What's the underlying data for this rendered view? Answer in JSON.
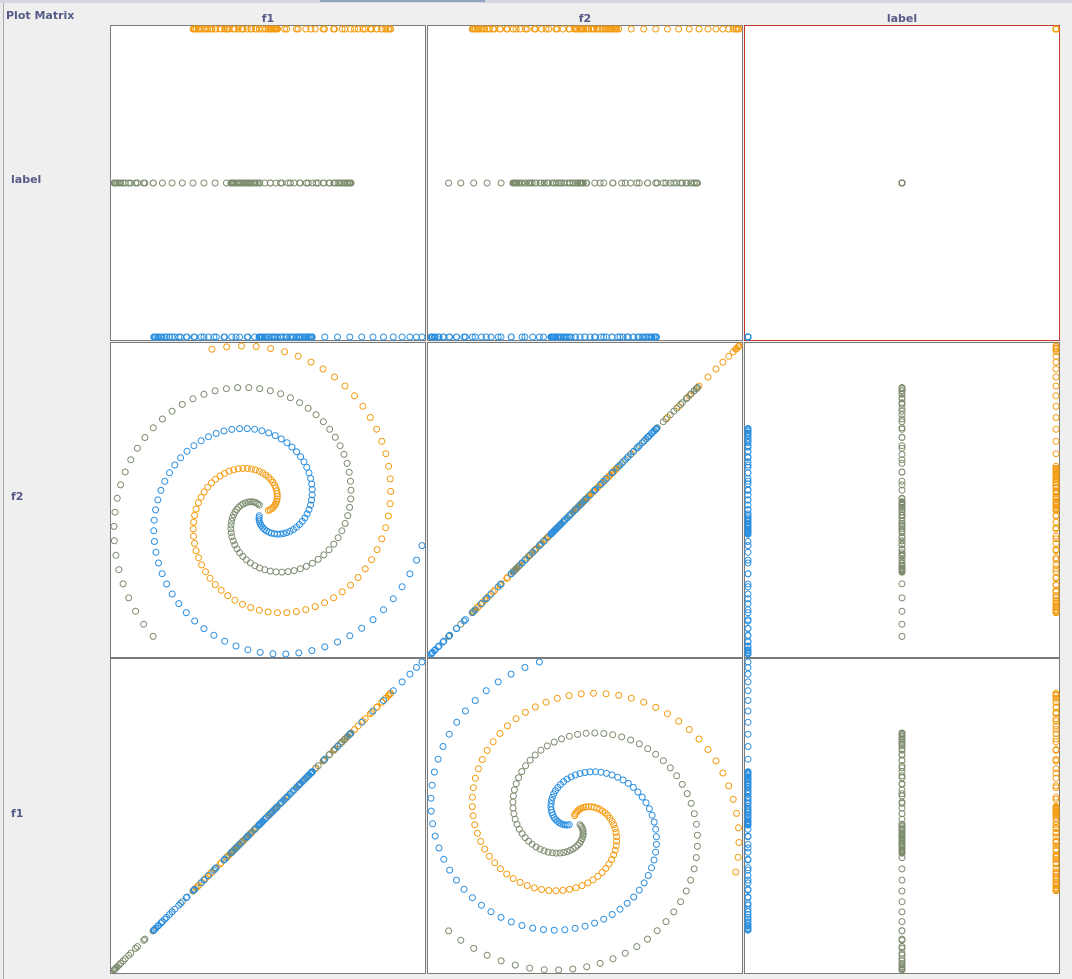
{
  "title": "Plot Matrix",
  "columns": [
    "f1",
    "f2",
    "label"
  ],
  "rows": [
    "label",
    "f2",
    "f1"
  ],
  "colors": {
    "class_a": "#f39c12",
    "class_b": "#7d8c6e",
    "class_c": "#2b8fe0",
    "selected_border": "#c0392b",
    "cell_border": "#7a7a7a"
  },
  "chart_data": {
    "type": "scatter",
    "variables": [
      "f1",
      "f2",
      "label"
    ],
    "label_values": {
      "class_a": 2,
      "class_b": 1,
      "class_c": 0
    },
    "ranges": {
      "f1": [
        -1,
        1
      ],
      "f2": [
        -1,
        1
      ],
      "label": [
        0,
        2
      ]
    },
    "grid": false,
    "series": [
      {
        "key": "class_a",
        "label": 2,
        "radius_start": 0.04,
        "radius_end": 1.08,
        "phase": 0,
        "turns": 1.3
      },
      {
        "key": "class_b",
        "label": 1,
        "radius_start": 0.04,
        "radius_end": 1.08,
        "phase": 2.0944,
        "turns": 1.3
      },
      {
        "key": "class_c",
        "label": 0,
        "radius_start": 0.04,
        "radius_end": 1.08,
        "phase": 4.1888,
        "turns": 1.3
      }
    ],
    "selected_cell": {
      "row": "label",
      "column": "label"
    }
  }
}
